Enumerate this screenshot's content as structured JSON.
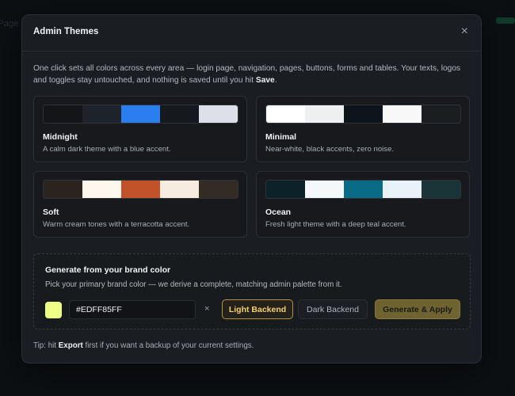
{
  "background": {
    "left_text": "i Page",
    "accent": "#123a2a"
  },
  "modal": {
    "title": "Admin Themes",
    "close_label": "×",
    "intro_before": "One click sets all colors across every area — login page, navigation, pages, buttons, forms and tables. Your texts, logos and toggles stay untouched, and nothing is saved until you hit ",
    "intro_bold": "Save",
    "intro_after": "."
  },
  "themes": [
    {
      "name": "Midnight",
      "description": "A calm dark theme with a blue accent.",
      "colors": [
        "#131518",
        "#1d222b",
        "#2a7ef0",
        "#15181c",
        "#dde1e7"
      ]
    },
    {
      "name": "Minimal",
      "description": "Near-white, black accents, zero noise.",
      "colors": [
        "#ffffff",
        "#eeeff1",
        "#0f131a",
        "#f8f8f8",
        "#1b1e21"
      ]
    },
    {
      "name": "Soft",
      "description": "Warm cream tones with a terracotta accent.",
      "colors": [
        "#2a231e",
        "#fdf7ee",
        "#c2522a",
        "#f7ece0",
        "#332c25"
      ]
    },
    {
      "name": "Ocean",
      "description": "Fresh light theme with a deep teal accent.",
      "colors": [
        "#0d2129",
        "#f4f8fb",
        "#0a6b87",
        "#e9f3f7",
        "#1b3437"
      ]
    }
  ],
  "brand": {
    "title": "Generate from your brand color",
    "description": "Pick your primary brand color — we derive a complete, matching admin palette from it.",
    "color": "#EDFF85",
    "hex_value": "#EDFF85FF",
    "clear_label": "×",
    "light_label": "Light Backend",
    "dark_label": "Dark Backend",
    "apply_label": "Generate & Apply"
  },
  "tip": {
    "before": "Tip: hit ",
    "bold": "Export",
    "after": " first if you want a backup of your current settings."
  }
}
